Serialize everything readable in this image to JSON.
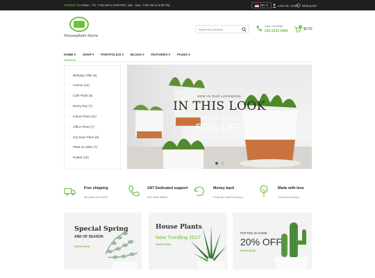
{
  "topbar": {
    "call": "ORDER NOW",
    "hours": "Mon - Fri: 7:00 AM to 8:00 PM   |   Sat - Sun: 7:00 AM to 5:00 PM",
    "language": "EN",
    "login": "LOG IN / JOIN",
    "wishlist": "WISHLIST"
  },
  "header": {
    "logo_text": "Houseplant Store",
    "search_placeholder": "Search for products",
    "call_label": "CALL US NOW",
    "call_number": "034 2333 3444",
    "cart_count": "0",
    "cart_total": "$0.00"
  },
  "nav": [
    "HOME ▾",
    "SHOP ▾",
    "PORTFOLIOS ▾",
    "BLOGS ▾",
    "FEATURES ▾",
    "PAGES ▾"
  ],
  "sidebar": [
    "Birthday Gifts (6)",
    "Cactus (12)",
    "Cafe Plant (8)",
    "Every Day (7)",
    "Indoor Plant (11)",
    "Office Plant (7)",
    "Out Door Plant (9)",
    "Plant on table (7)",
    "Potted (10)"
  ],
  "hero": {
    "kicker": "NEW IN OUR LOOKBOOK",
    "title": "IN THIS LOOK",
    "subtitle": "SPRING STORE",
    "offer": "50% OFF"
  },
  "features": [
    {
      "title": "Free shipping",
      "subtitle": "All order over $100"
    },
    {
      "title": "24/7 Dedicated support",
      "subtitle": "032 4534 54666"
    },
    {
      "title": "Money back",
      "subtitle": "If the item didn't suit you"
    },
    {
      "title": "Made with love",
      "subtitle": "The best services"
    }
  ],
  "banners": [
    {
      "title": "Special Spring",
      "subtitle": "AND OF SEASON",
      "link": "SHOP NOW"
    },
    {
      "title": "House Plants",
      "subtitle": "New Trending 2017",
      "link": "SHOP NOW"
    },
    {
      "kicker": "POTTED IN HOME",
      "title": "20% OFF",
      "link": "SHOP NOW"
    }
  ],
  "colors": {
    "accent": "#6fbf3a",
    "topbar": "#1f1f1f",
    "terracotta": "#c9743f"
  }
}
